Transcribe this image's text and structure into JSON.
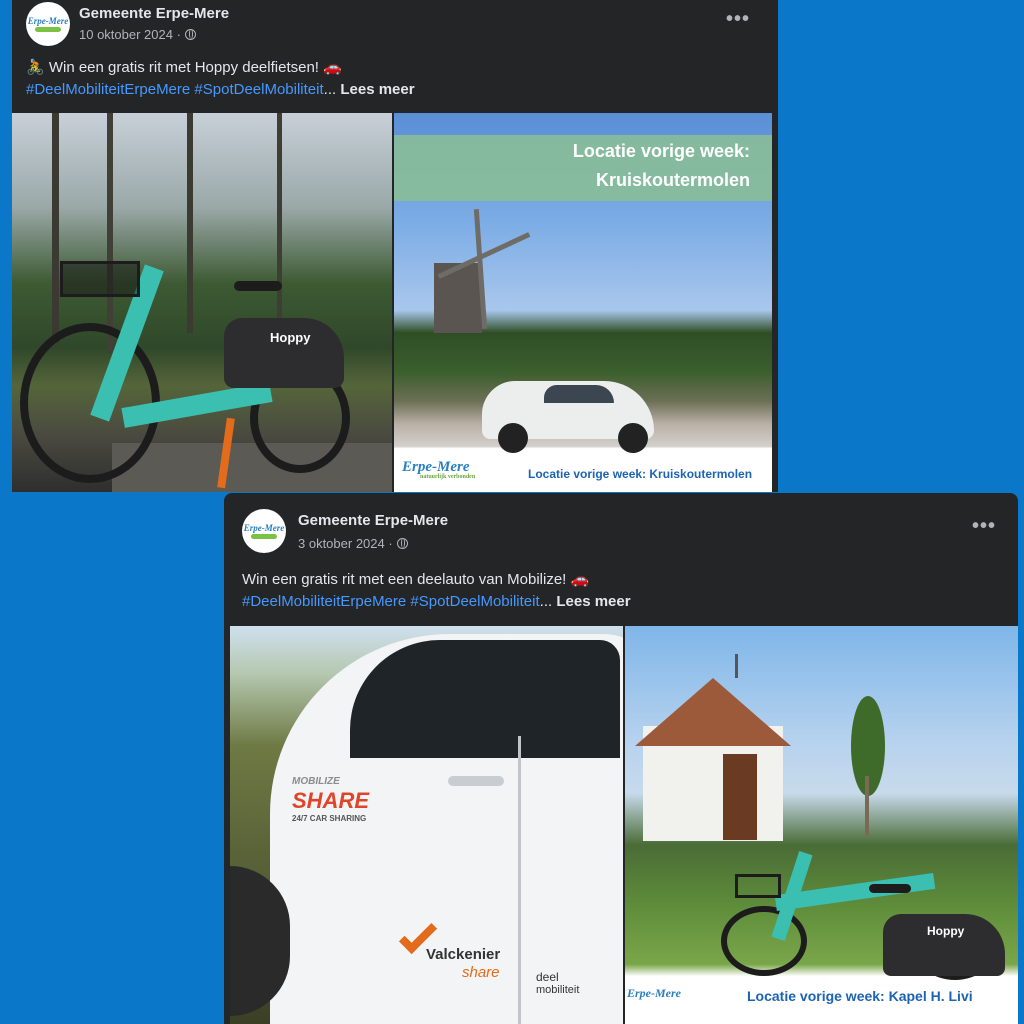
{
  "posts": [
    {
      "author": "Gemeente Erpe-Mere",
      "date": "10 oktober 2024 ·",
      "message": "🚴 Win een gratis rit met Hoppy deelfietsen! 🚗",
      "hashtags": "#DeelMobiliteitErpeMere #SpotDeelMobiliteit",
      "ellipsis": "...",
      "read_more": "Lees meer",
      "more_icon": "•••",
      "avatar": {
        "line1": "Erpe-Mere"
      },
      "photo_right": {
        "banner_line1": "Locatie vorige week:",
        "banner_line2": "Kruiskoutermolen",
        "footer_logo": "Erpe-Mere",
        "footer_logo_sub": "natuurlijk verbonden",
        "footer_text": "Locatie vorige week: Kruiskoutermolen"
      },
      "photo_left": {
        "brand": "Hoppy"
      }
    },
    {
      "author": "Gemeente Erpe-Mere",
      "date": "3 oktober 2024 ·",
      "message": "Win een gratis rit met een deelauto van Mobilize! 🚗",
      "hashtags": "#DeelMobiliteitErpeMere #SpotDeelMobiliteit",
      "ellipsis": "...",
      "read_more": "Lees meer",
      "more_icon": "•••",
      "avatar": {
        "line1": "Erpe-Mere"
      },
      "photo_left": {
        "mobilize": "MOBILIZE",
        "share": "SHARE",
        "carsharing": "24/7 CAR SHARING",
        "valckenier": "Valckenier",
        "valck_share": "share",
        "deel": "deel",
        "mobiliteit": "mobiliteit"
      },
      "photo_right": {
        "footer_logo": "Erpe-Mere",
        "footer_text": "Locatie vorige week: Kapel H. Livi",
        "brand": "Hoppy"
      }
    }
  ],
  "colors": {
    "background": "#0a77c9",
    "card": "#242526",
    "hashtag": "#4599ff",
    "footer_text": "#1d63b3"
  },
  "icons": [
    "globe-icon",
    "more-options-icon"
  ]
}
